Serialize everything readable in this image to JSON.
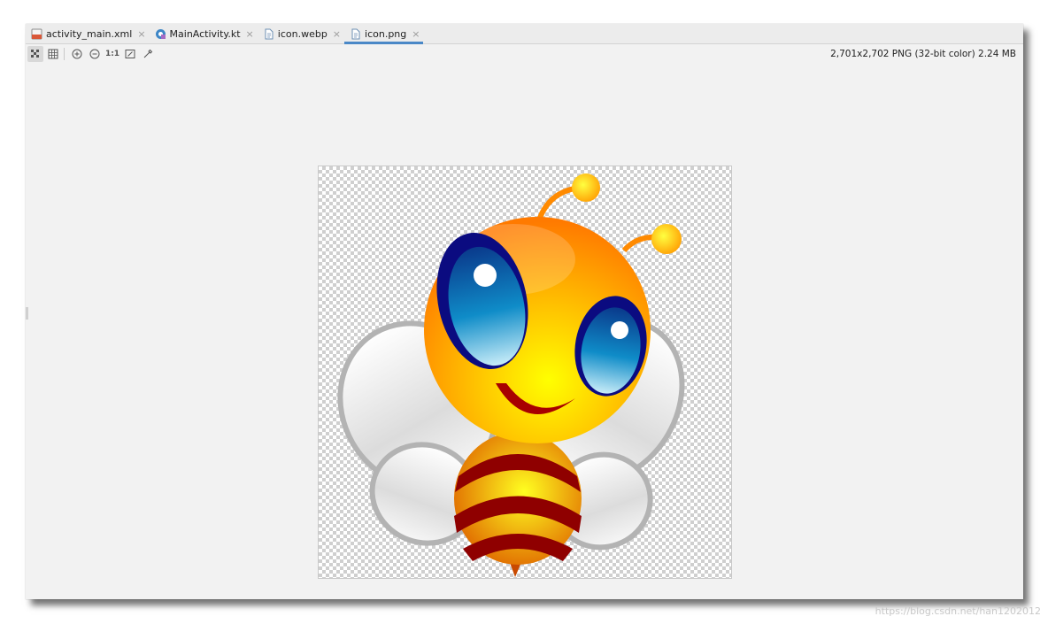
{
  "tabs": [
    {
      "label": "activity_main.xml",
      "icon": "xml-file-icon",
      "active": false
    },
    {
      "label": "MainActivity.kt",
      "icon": "kotlin-file-icon",
      "active": false
    },
    {
      "label": "icon.webp",
      "icon": "image-file-icon",
      "active": false
    },
    {
      "label": "icon.png",
      "icon": "image-file-icon",
      "active": true
    }
  ],
  "tab_close_glyph": "×",
  "toolbar": {
    "actual_size_label": "1:1"
  },
  "image_info": "2,701x2,702 PNG (32-bit color) 2.24 MB",
  "watermark": "https://blog.csdn.net/han1202012",
  "colors": {
    "active_tab_underline": "#4a88c7",
    "editor_background": "#f2f2f2"
  }
}
